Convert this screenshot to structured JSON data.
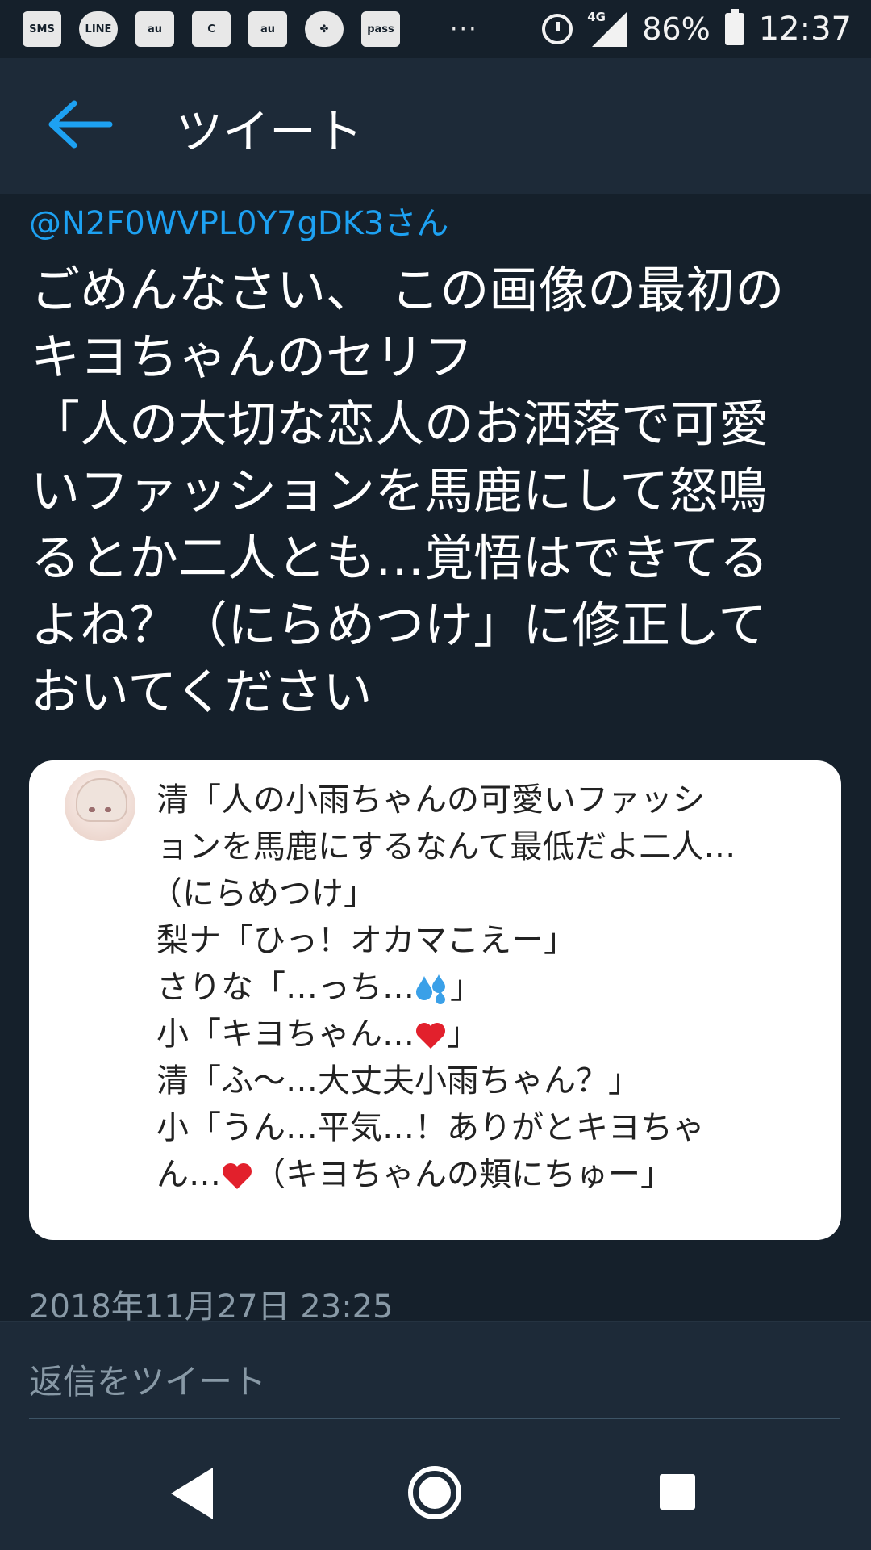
{
  "status_bar": {
    "icons": [
      "SMS",
      "LINE",
      "au",
      "C",
      "au",
      "✤",
      "pass"
    ],
    "more": "···",
    "network": "4G",
    "battery": "86%",
    "time": "12:37"
  },
  "header": {
    "title": "ツイート"
  },
  "tweet": {
    "reply_to": "@N2F0WVPL0Y7gDK3さん",
    "text": "ごめんなさい、 この画像の最初の\nキヨちゃんのセリフ\n「人の大切な恋人のお洒落で可愛\nいファッションを馬鹿にして怒鳴\nるとか二人とも…覚悟はできてる\nよね？（にらめつけ」に修正して\nおいてください",
    "timestamp": "2018年11月27日 23:25"
  },
  "image_card": {
    "lines": [
      "清「人の小雨ちゃんの可愛いファッシ",
      "ョンを馬鹿にするなんて最低だよ二人…",
      "（にらめつけ」",
      "梨ナ「ひっ！オカマこえー」",
      "さりな「…っち…",
      "」",
      "小「キヨちゃん…",
      "」",
      "清「ふ〜…大丈夫小雨ちゃん？」",
      "小「うん…平気…！ありがとキヨちゃ",
      "ん…",
      "（キヨちゃんの頬にちゅー」"
    ]
  },
  "reply": {
    "placeholder": "返信をツイート"
  },
  "colors": {
    "background": "#15202b",
    "header": "#1d2a38",
    "accent": "#1da1f2",
    "muted": "#8899a6"
  }
}
